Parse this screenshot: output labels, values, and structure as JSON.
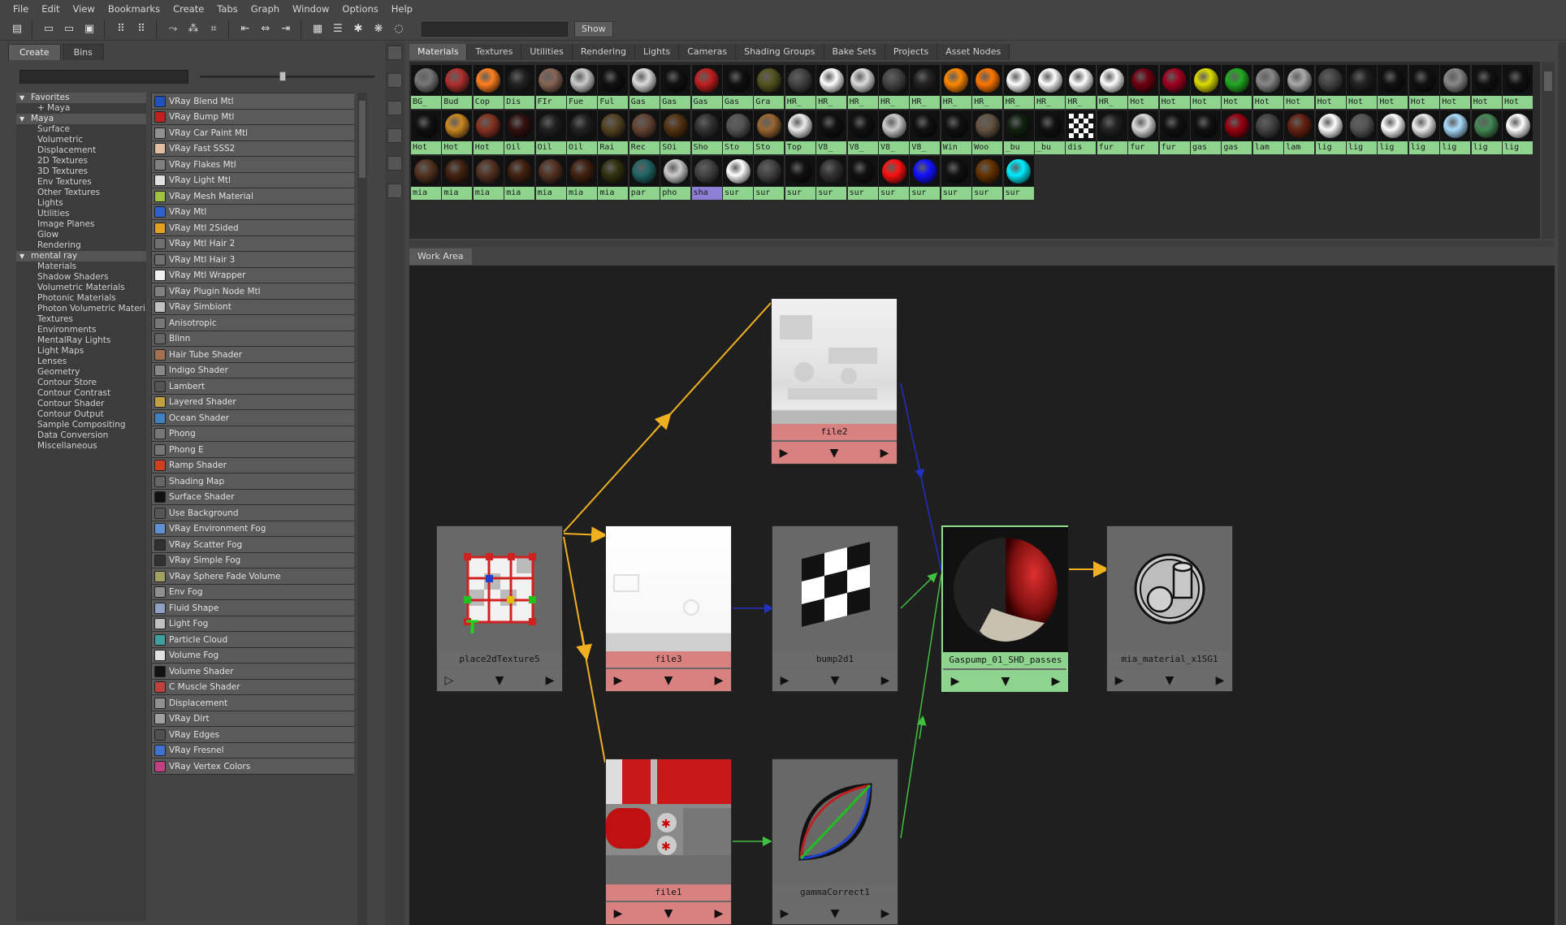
{
  "menu": [
    "File",
    "Edit",
    "View",
    "Bookmarks",
    "Create",
    "Tabs",
    "Graph",
    "Window",
    "Options",
    "Help"
  ],
  "toolbar": {
    "show_label": "Show"
  },
  "left_tabs": [
    "Create",
    "Bins"
  ],
  "tree": [
    {
      "label": "Favorites",
      "header": true
    },
    {
      "label": "+ Maya"
    },
    {
      "label": "Maya",
      "header": true
    },
    {
      "label": "Surface"
    },
    {
      "label": "Volumetric"
    },
    {
      "label": "Displacement"
    },
    {
      "label": "2D Textures"
    },
    {
      "label": "3D Textures"
    },
    {
      "label": "Env Textures"
    },
    {
      "label": "Other Textures"
    },
    {
      "label": "Lights"
    },
    {
      "label": "Utilities"
    },
    {
      "label": "Image Planes"
    },
    {
      "label": "Glow"
    },
    {
      "label": "Rendering"
    },
    {
      "label": "mental ray",
      "header": true
    },
    {
      "label": "Materials"
    },
    {
      "label": "Shadow Shaders"
    },
    {
      "label": "Volumetric Materials"
    },
    {
      "label": "Photonic Materials"
    },
    {
      "label": "Photon Volumetric Materi..."
    },
    {
      "label": "Textures"
    },
    {
      "label": "Environments"
    },
    {
      "label": "MentalRay Lights"
    },
    {
      "label": "Light Maps"
    },
    {
      "label": "Lenses"
    },
    {
      "label": "Geometry"
    },
    {
      "label": "Contour Store"
    },
    {
      "label": "Contour Contrast"
    },
    {
      "label": "Contour Shader"
    },
    {
      "label": "Contour Output"
    },
    {
      "label": "Sample Compositing"
    },
    {
      "label": "Data Conversion"
    },
    {
      "label": "Miscellaneous"
    }
  ],
  "node_list": [
    {
      "label": "VRay Blend Mtl",
      "color": "#2050c0"
    },
    {
      "label": "VRay Bump Mtl",
      "color": "#c02020"
    },
    {
      "label": "VRay Car Paint Mtl",
      "color": "#909090"
    },
    {
      "label": "VRay Fast SSS2",
      "color": "#e0c0a0"
    },
    {
      "label": "VRay Flakes Mtl",
      "color": "#808080"
    },
    {
      "label": "VRay Light Mtl",
      "color": "#e0e0e0"
    },
    {
      "label": "VRay Mesh Material",
      "color": "#a0c040"
    },
    {
      "label": "VRay Mtl",
      "color": "#3060d0"
    },
    {
      "label": "VRay Mtl 2Sided",
      "color": "#e0a020"
    },
    {
      "label": "VRay Mtl Hair 2",
      "color": "#707070"
    },
    {
      "label": "VRay Mtl Hair 3",
      "color": "#707070"
    },
    {
      "label": "VRay Mtl Wrapper",
      "color": "#f0f0f0"
    },
    {
      "label": "VRay Plugin Node Mtl",
      "color": "#808080"
    },
    {
      "label": "VRay Simbiont",
      "color": "#c0c0c0"
    },
    {
      "label": "Anisotropic",
      "color": "#777"
    },
    {
      "label": "Blinn",
      "color": "#666"
    },
    {
      "label": "Hair Tube Shader",
      "color": "#a07050"
    },
    {
      "label": "Indigo Shader",
      "color": "#888"
    },
    {
      "label": "Lambert",
      "color": "#555"
    },
    {
      "label": "Layered Shader",
      "color": "#c0a040"
    },
    {
      "label": "Ocean Shader",
      "color": "#4080c0"
    },
    {
      "label": "Phong",
      "color": "#777"
    },
    {
      "label": "Phong E",
      "color": "#777"
    },
    {
      "label": "Ramp Shader",
      "color": "#d04020"
    },
    {
      "label": "Shading Map",
      "color": "#666"
    },
    {
      "label": "Surface Shader",
      "color": "#111"
    },
    {
      "label": "Use Background",
      "color": "#555"
    },
    {
      "label": "VRay Environment Fog",
      "color": "#6090d0"
    },
    {
      "label": "VRay Scatter Fog",
      "color": "#303030"
    },
    {
      "label": "VRay Simple Fog",
      "color": "#303030"
    },
    {
      "label": "VRay Sphere Fade Volume",
      "color": "#a0a060"
    },
    {
      "label": "Env Fog",
      "color": "#909090"
    },
    {
      "label": "Fluid Shape",
      "color": "#90a0c0"
    },
    {
      "label": "Light Fog",
      "color": "#c0c0c0"
    },
    {
      "label": "Particle Cloud",
      "color": "#40a0a0"
    },
    {
      "label": "Volume Fog",
      "color": "#e0e0e0"
    },
    {
      "label": "Volume Shader",
      "color": "#111"
    },
    {
      "label": "C Muscle Shader",
      "color": "#c04040"
    },
    {
      "label": "Displacement",
      "color": "#909090"
    },
    {
      "label": "VRay Dirt",
      "color": "#a0a0a0"
    },
    {
      "label": "VRay Edges",
      "color": "#505050"
    },
    {
      "label": "VRay Fresnel",
      "color": "#4070d0"
    },
    {
      "label": "VRay Vertex Colors",
      "color": "#c04080"
    }
  ],
  "tabs": [
    "Materials",
    "Textures",
    "Utilities",
    "Rendering",
    "Lights",
    "Cameras",
    "Shading Groups",
    "Bake Sets",
    "Projects",
    "Asset Nodes"
  ],
  "swatch_rows": [
    [
      {
        "l": "BG_",
        "c": "#777"
      },
      {
        "l": "Bud",
        "c": "#b03030"
      },
      {
        "l": "Cop",
        "c": "#ff8020"
      },
      {
        "l": "Dis",
        "c": "#222"
      },
      {
        "l": "FIr",
        "c": "#886655"
      },
      {
        "l": "Fue",
        "c": "#ccc"
      },
      {
        "l": "Ful",
        "c": "#111"
      },
      {
        "l": "Gas",
        "c": "#ddd"
      },
      {
        "l": "Gas",
        "c": "#111"
      },
      {
        "l": "Gas",
        "c": "#c02020"
      },
      {
        "l": "Gas",
        "c": "#111"
      },
      {
        "l": "Gra",
        "c": "#555522"
      },
      {
        "l": "HR_",
        "c": "#444"
      },
      {
        "l": "HR_",
        "c": "#fff"
      },
      {
        "l": "HR_",
        "c": "#ddd"
      },
      {
        "l": "HR_",
        "c": "#444"
      },
      {
        "l": "HR_",
        "c": "#222"
      },
      {
        "l": "HR_",
        "c": "#ff8800"
      },
      {
        "l": "HR_",
        "c": "#ff7700"
      },
      {
        "l": "HR_",
        "c": "#fff"
      },
      {
        "l": "HR_",
        "c": "#fff"
      },
      {
        "l": "HR_",
        "c": "#fff"
      },
      {
        "l": "HR_",
        "c": "#fff"
      },
      {
        "l": "Hot",
        "c": "#700010"
      },
      {
        "l": "Hot",
        "c": "#a00020"
      },
      {
        "l": "Hot",
        "c": "#dddd00"
      },
      {
        "l": "Hot",
        "c": "#22aa22"
      },
      {
        "l": "Hot",
        "c": "#888"
      },
      {
        "l": "Hot",
        "c": "#aaa"
      },
      {
        "l": "Hot",
        "c": "#444"
      },
      {
        "l": "Hot",
        "c": "#222"
      },
      {
        "l": "Hot",
        "c": "#111"
      },
      {
        "l": "Hot",
        "c": "#111"
      },
      {
        "l": "Hot",
        "c": "#888"
      },
      {
        "l": "Hot",
        "c": "#111"
      },
      {
        "l": "Hot",
        "c": "#111"
      }
    ],
    [
      {
        "l": "Hot",
        "c": "#111"
      },
      {
        "l": "Hot",
        "c": "#cc8822"
      },
      {
        "l": "Hot",
        "c": "#883322"
      },
      {
        "l": "Oil",
        "c": "#331111"
      },
      {
        "l": "Oil",
        "c": "#222"
      },
      {
        "l": "Oil",
        "c": "#222"
      },
      {
        "l": "Rai",
        "c": "#554422"
      },
      {
        "l": "Rec",
        "c": "#664433"
      },
      {
        "l": "SOi",
        "c": "#553311"
      },
      {
        "l": "Sho",
        "c": "#333"
      },
      {
        "l": "Sto",
        "c": "#555"
      },
      {
        "l": "Sto",
        "c": "#996633"
      },
      {
        "l": "Top",
        "c": "#eee"
      },
      {
        "l": "V8_",
        "c": "#111"
      },
      {
        "l": "V8_",
        "c": "#111"
      },
      {
        "l": "V8_",
        "c": "#ccc"
      },
      {
        "l": "V8_",
        "c": "#111"
      },
      {
        "l": "Win",
        "c": "#111"
      },
      {
        "l": "Woo",
        "c": "#665544"
      },
      {
        "l": "_bu",
        "c": "#112211"
      },
      {
        "l": "_bu",
        "c": "#111"
      },
      {
        "l": "dis",
        "c": "#999",
        "sel2": true
      },
      {
        "l": "fur",
        "c": "#222"
      },
      {
        "l": "fur",
        "c": "#ddd"
      },
      {
        "l": "fur",
        "c": "#111"
      },
      {
        "l": "gas",
        "c": "#111"
      },
      {
        "l": "gas",
        "c": "#990011"
      },
      {
        "l": "lam",
        "c": "#444"
      },
      {
        "l": "lam",
        "c": "#662211"
      },
      {
        "l": "lig",
        "c": "#fff"
      },
      {
        "l": "lig",
        "c": "#555"
      },
      {
        "l": "lig",
        "c": "#fff"
      },
      {
        "l": "lig",
        "c": "#eee"
      },
      {
        "l": "lig",
        "c": "#aaddff"
      },
      {
        "l": "lig",
        "c": "#448855"
      },
      {
        "l": "lig",
        "c": "#fff"
      }
    ],
    [
      {
        "l": "mia",
        "c": "#553322"
      },
      {
        "l": "mia",
        "c": "#442211"
      },
      {
        "l": "mia",
        "c": "#553322"
      },
      {
        "l": "mia",
        "c": "#442211"
      },
      {
        "l": "mia",
        "c": "#553322"
      },
      {
        "l": "mia",
        "c": "#442211"
      },
      {
        "l": "mia",
        "c": "#333311"
      },
      {
        "l": "par",
        "c": "#226666"
      },
      {
        "l": "pho",
        "c": "#ccc"
      },
      {
        "l": "sha",
        "c": "#444",
        "sel": true
      },
      {
        "l": "sur",
        "c": "#fff"
      },
      {
        "l": "sur",
        "c": "#444"
      },
      {
        "l": "sur",
        "c": "#111"
      },
      {
        "l": "sur",
        "c": "#333"
      },
      {
        "l": "sur",
        "c": "#111"
      },
      {
        "l": "sur",
        "c": "#ff1111"
      },
      {
        "l": "sur",
        "c": "#1111ff"
      },
      {
        "l": "sur",
        "c": "#111"
      },
      {
        "l": "sur",
        "c": "#663300"
      },
      {
        "l": "sur",
        "c": "#00eeff"
      }
    ]
  ],
  "work_area_label": "Work Area",
  "nodes": {
    "place2d": "place2dTexture5",
    "file2": "file2",
    "file3": "file3",
    "bump": "bump2d1",
    "mat": "Gaspump_01_SHD_passes",
    "sg": "mia_material_x1SG1",
    "file1": "file1",
    "gamma": "gammaCorrect1"
  },
  "colors": {
    "yellow_wire": "#f0b020",
    "green_wire": "#40c040",
    "blue_wire": "#2030c0",
    "green_node": "#8ed48f",
    "tex_node": "#d98080"
  }
}
